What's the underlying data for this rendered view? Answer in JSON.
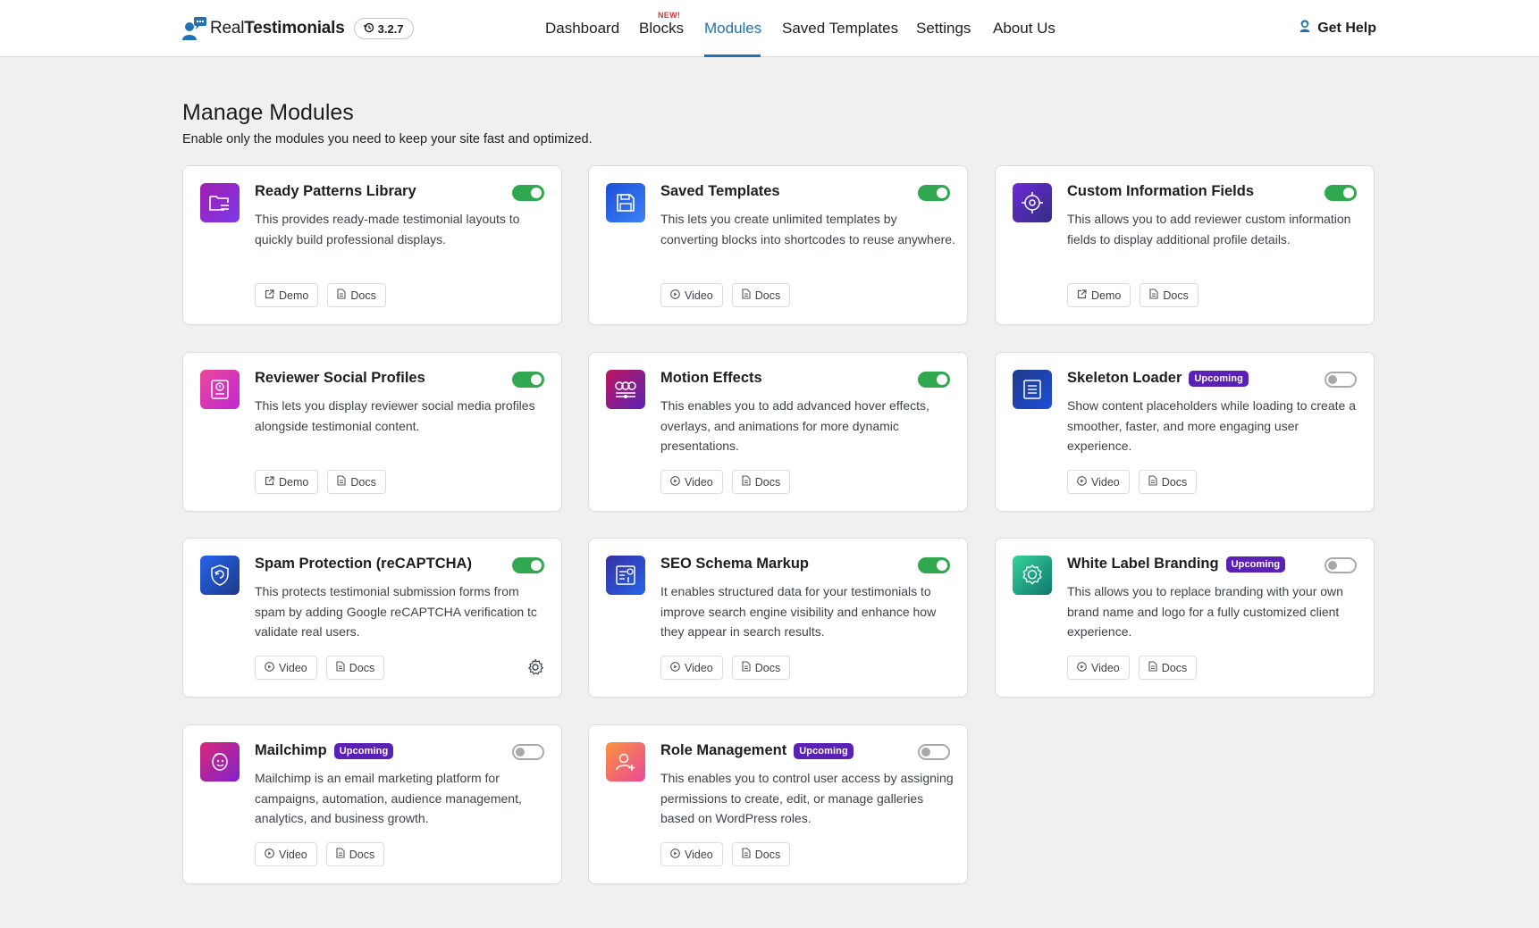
{
  "header": {
    "brand_light": "Real",
    "brand_bold": "Testimonials",
    "version": "3.2.7",
    "nav": [
      {
        "label": "Dashboard"
      },
      {
        "label": "Blocks",
        "tag": "NEW!"
      },
      {
        "label": "Modules",
        "active": true
      },
      {
        "label": "Saved Templates"
      },
      {
        "label": "Settings"
      },
      {
        "label": "About Us"
      }
    ],
    "help_label": "Get Help"
  },
  "page": {
    "title": "Manage Modules",
    "subtitle": "Enable only the modules you need to keep your site fast and optimized."
  },
  "colors": {
    "accent": "#2271b1",
    "toggle_on": "#2fa84f",
    "badge": "#5b21b6"
  },
  "modules": [
    {
      "title": "Ready Patterns Library",
      "desc": "This provides ready-made testimonial layouts to quickly build professional displays.",
      "enabled": true,
      "badge": "",
      "actions": [
        "Demo",
        "Docs"
      ],
      "icon": "folder-icon"
    },
    {
      "title": "Saved Templates",
      "desc": "This lets you create unlimited templates by converting blocks into shortcodes to reuse anywhere.",
      "enabled": true,
      "badge": "",
      "actions": [
        "Video",
        "Docs"
      ],
      "icon": "save-icon"
    },
    {
      "title": "Custom Information Fields",
      "desc": "This allows you to add reviewer custom information fields to display additional profile details.",
      "enabled": true,
      "badge": "",
      "actions": [
        "Demo",
        "Docs"
      ],
      "icon": "at-target-icon"
    },
    {
      "title": "Reviewer Social Profiles",
      "desc": "This lets you display reviewer social media profiles alongside testimonial content.",
      "enabled": true,
      "badge": "",
      "actions": [
        "Demo",
        "Docs"
      ],
      "icon": "profile-card-icon"
    },
    {
      "title": "Motion Effects",
      "desc": "This enables you to add advanced hover effects, overlays, and animations for more dynamic presentations.",
      "enabled": true,
      "badge": "",
      "actions": [
        "Video",
        "Docs"
      ],
      "icon": "motion-icon"
    },
    {
      "title": "Skeleton Loader",
      "desc": "Show content placeholders while loading to create a smoother, faster, and more engaging user experience.",
      "enabled": false,
      "badge": "Upcoming",
      "actions": [
        "Video",
        "Docs"
      ],
      "icon": "document-lines-icon"
    },
    {
      "title": "Spam Protection (reCAPTCHA)",
      "desc": "This protects testimonial submission forms from spam by adding Google reCAPTCHA verification tc validate real users.",
      "enabled": true,
      "badge": "",
      "actions": [
        "Video",
        "Docs"
      ],
      "icon": "shield-icon",
      "settings": true
    },
    {
      "title": "SEO Schema Markup",
      "desc": "It enables structured data for your testimonials to improve search engine visibility and enhance how they appear in search results.",
      "enabled": true,
      "badge": "",
      "actions": [
        "Video",
        "Docs"
      ],
      "icon": "schema-icon"
    },
    {
      "title": "White Label Branding",
      "desc": "This allows you to replace branding with your own brand name and logo for a fully customized client experience.",
      "enabled": false,
      "badge": "Upcoming",
      "actions": [
        "Video",
        "Docs"
      ],
      "icon": "badge-gear-icon"
    },
    {
      "title": "Mailchimp",
      "desc": "Mailchimp is an email marketing platform for campaigns, automation, audience management, analytics, and business growth.",
      "enabled": false,
      "badge": "Upcoming",
      "actions": [
        "Video",
        "Docs"
      ],
      "icon": "mailchimp-icon"
    },
    {
      "title": "Role Management",
      "desc": "This enables you to control user access by assigning permissions to create, edit, or manage galleries based on WordPress roles.",
      "enabled": false,
      "badge": "Upcoming",
      "actions": [
        "Video",
        "Docs"
      ],
      "icon": "user-add-icon"
    }
  ]
}
